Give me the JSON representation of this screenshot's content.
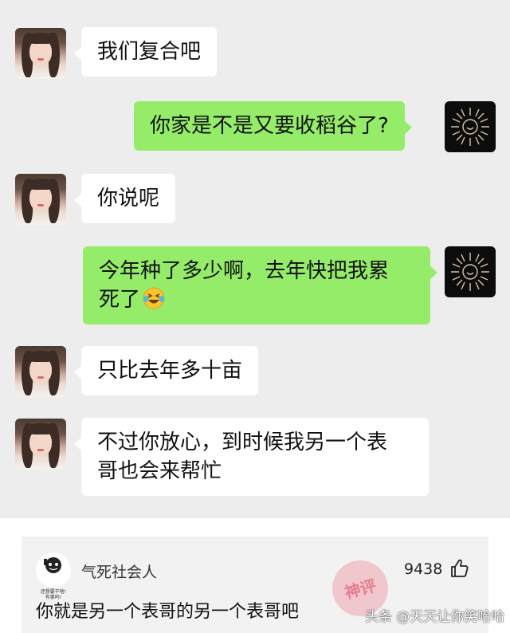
{
  "chat": {
    "messages": [
      {
        "sender": "her",
        "text": "我们复合吧"
      },
      {
        "sender": "me",
        "text": "你家是不是又要收稻谷了?"
      },
      {
        "sender": "her",
        "text": "你说呢"
      },
      {
        "sender": "me",
        "line1": "今年种了多少啊，去年快把我累",
        "line2": "死了",
        "emoji": "laughing-crying-emoji"
      },
      {
        "sender": "her",
        "text": "只比去年多十亩"
      },
      {
        "sender": "her",
        "line1": "不过你放心，到时候我另一个表",
        "line2": "哥也会来帮忙"
      }
    ]
  },
  "comment": {
    "avatar_caption_1": "还想要干啥!",
    "avatar_caption_2": "有事吗!",
    "username": "气死社会人",
    "likes": "9438",
    "text": "你就是另一个表哥的另一个表哥吧",
    "stamp": "神评"
  },
  "watermark": "头条 @天天让你笑哈哈",
  "colors": {
    "chat_background": "#ededed",
    "bubble_left": "#ffffff",
    "bubble_right": "#95ec69",
    "comment_background": "#f2f2f2"
  }
}
